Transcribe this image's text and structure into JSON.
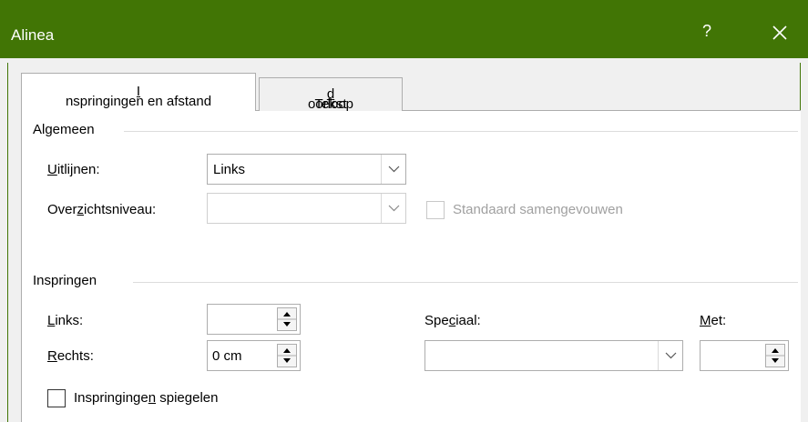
{
  "titlebar": {
    "title": "Alinea",
    "help_label": "?",
    "close_icon": "close-icon"
  },
  "tabs": [
    {
      "pre": "",
      "accel": "I",
      "post": "nspringingen en afstand",
      "active": true
    },
    {
      "pre": "Tekst",
      "accel": "d",
      "post": "oorloop",
      "active": false
    }
  ],
  "general": {
    "group_label": "Algemeen",
    "alignment": {
      "pre": "",
      "accel": "U",
      "post": "itlijnen:",
      "value": "Links"
    },
    "outline_level": {
      "pre": "Over",
      "accel": "z",
      "post": "ichtsniveau:",
      "value": ""
    },
    "collapsed_checkbox": {
      "label": "Standaard samengevouwen",
      "checked": false,
      "disabled": true
    }
  },
  "indent": {
    "group_label": "Inspringen",
    "left": {
      "pre": "",
      "accel": "L",
      "post": "inks:",
      "value": ""
    },
    "right": {
      "pre": "",
      "accel": "R",
      "post": "echts:",
      "value": "0 cm"
    },
    "special": {
      "pre": "Spe",
      "accel": "c",
      "post": "iaal:",
      "value": ""
    },
    "by": {
      "pre": "",
      "accel": "M",
      "post": "et:",
      "value": ""
    },
    "mirror_checkbox": {
      "pre": "Inspringinge",
      "accel": "n",
      "post": " spiegelen",
      "checked": false
    }
  },
  "colors": {
    "titlebar": "#417505",
    "panel": "#ffffff",
    "window": "#f0f0f0"
  }
}
